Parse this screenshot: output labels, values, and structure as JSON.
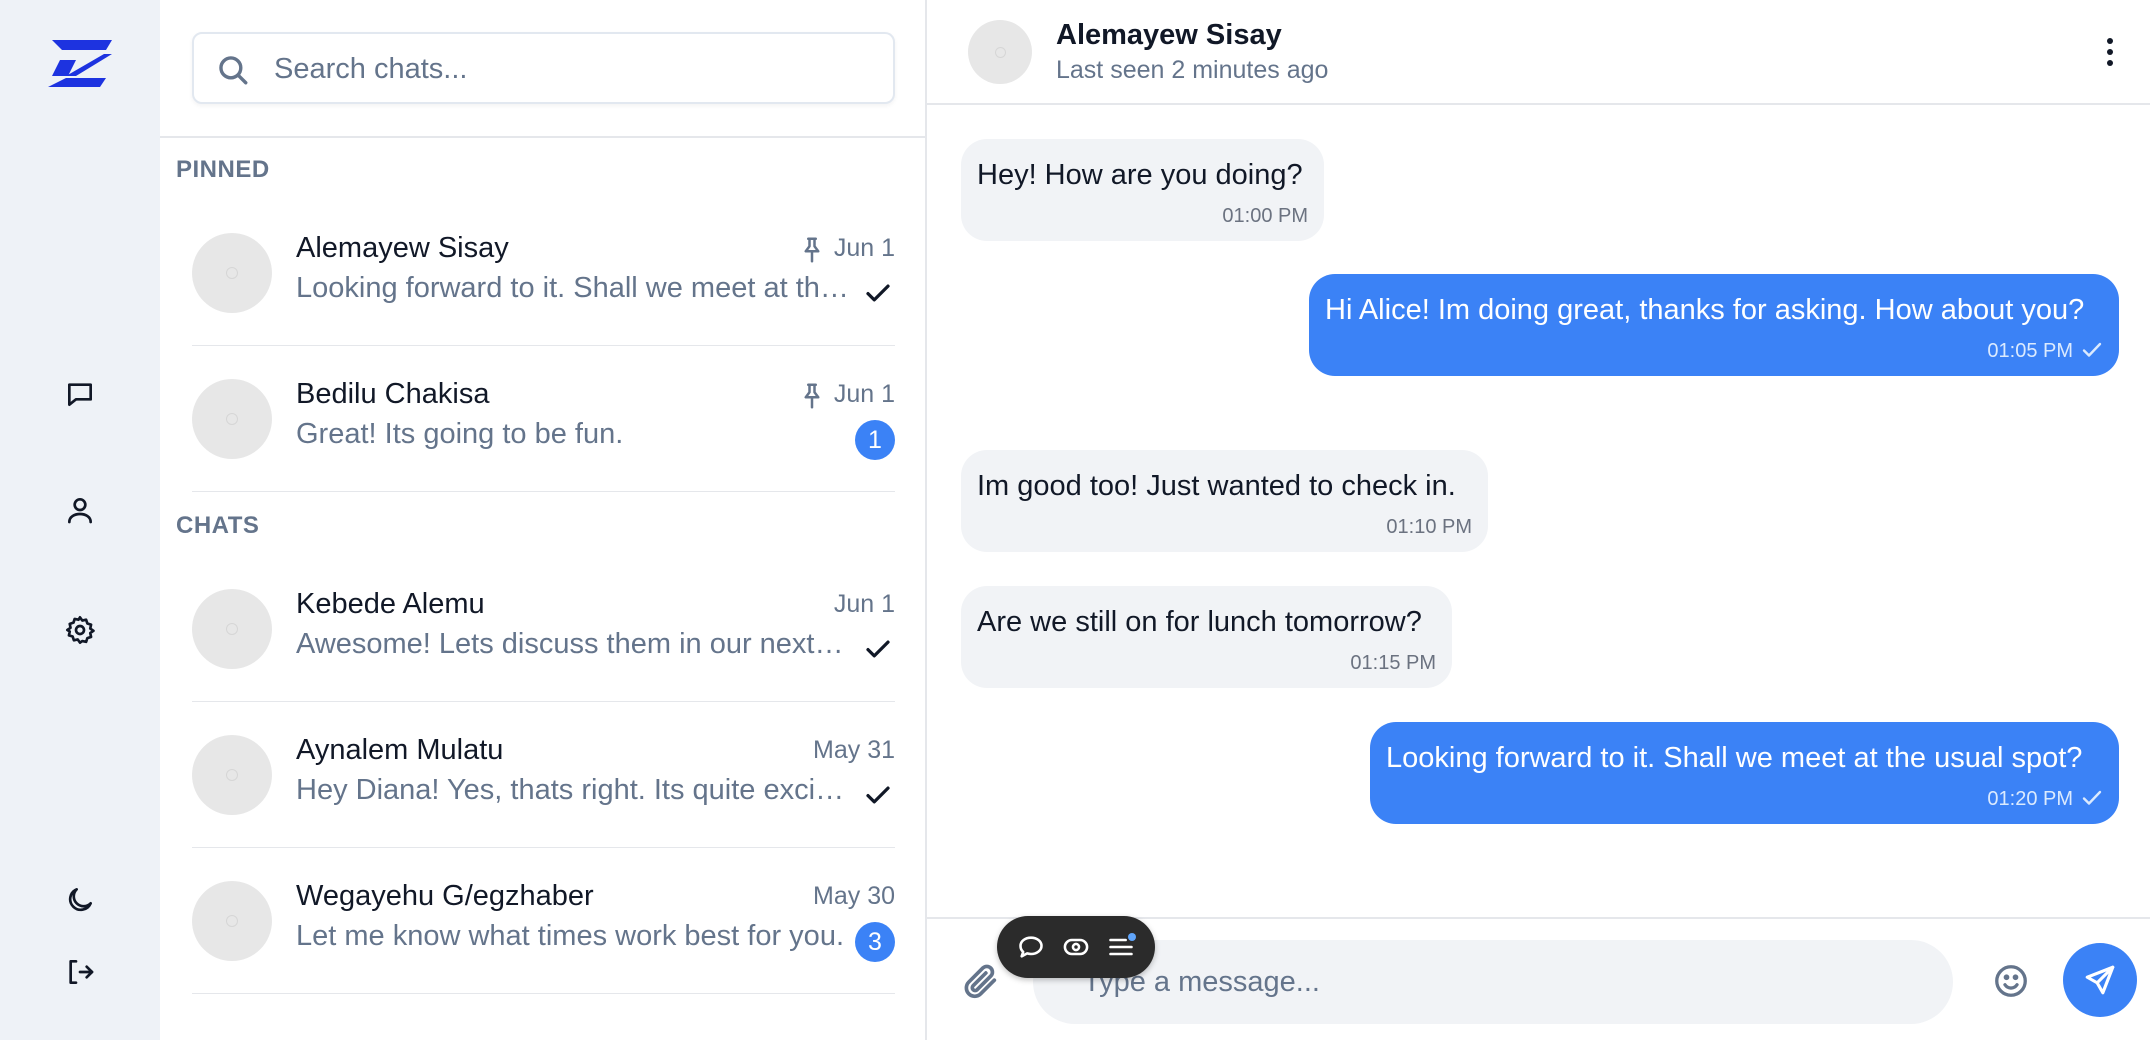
{
  "colors": {
    "accent": "#3b82f6",
    "rail_bg": "#eef2f7",
    "muted_text": "#64748b",
    "incoming_bubble": "#f1f3f6",
    "toolbar_bg": "#2b2b2b"
  },
  "rail": {
    "logo": "app-logo",
    "nav_icons": [
      "chat-icon",
      "user-icon",
      "settings-icon"
    ],
    "bottom_icons": [
      "moon-icon",
      "logout-icon"
    ]
  },
  "search": {
    "placeholder": "Search chats...",
    "icon": "search-icon"
  },
  "sections": {
    "pinned_label": "PINNED",
    "chats_label": "CHATS"
  },
  "pinned_chats": [
    {
      "name": "Alemayew Sisay",
      "preview": "Looking forward to it. Shall we meet at the usual spot?",
      "date": "Jun 1",
      "pinned": true,
      "status": "read"
    },
    {
      "name": "Bedilu Chakisa",
      "preview": "Great! Its going to be fun.",
      "date": "Jun 1",
      "pinned": true,
      "unread": "1"
    }
  ],
  "chats": [
    {
      "name": "Kebede Alemu",
      "preview": "Awesome! Lets discuss them in our next meeting.",
      "date": "Jun 1",
      "status": "read"
    },
    {
      "name": "Aynalem Mulatu",
      "preview": "Hey Diana! Yes, thats right. Its quite exciting.",
      "date": "May 31",
      "status": "read"
    },
    {
      "name": "Wegayehu G/egzhaber",
      "preview": "Let me know what times work best for you.",
      "date": "May 30",
      "unread": "3"
    }
  ],
  "conversation": {
    "contact_name": "Alemayew Sisay",
    "last_seen": "Last seen 2 minutes ago",
    "messages": [
      {
        "direction": "in",
        "text": "Hey! How are you doing?",
        "time": "01:00 PM"
      },
      {
        "direction": "out",
        "text": "Hi Alice! Im doing great, thanks for asking. How about you?",
        "time": "01:05 PM"
      },
      {
        "direction": "in",
        "text": "Im good too! Just wanted to check in.",
        "time": "01:10 PM"
      },
      {
        "direction": "in",
        "text": "Are we still on for lunch tomorrow?",
        "time": "01:15 PM"
      },
      {
        "direction": "out",
        "text": "Looking forward to it. Shall we meet at the usual spot?",
        "time": "01:20 PM"
      }
    ]
  },
  "composer": {
    "placeholder": "Type a message...",
    "attach_icon": "paperclip-icon",
    "emoji_icon": "smile-icon",
    "send_icon": "send-icon"
  },
  "floating_toolbar": {
    "icons": [
      "comment-icon",
      "eye-icon",
      "list-icon"
    ]
  }
}
